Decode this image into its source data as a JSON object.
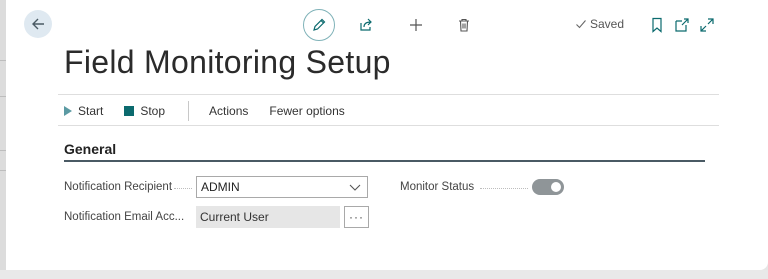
{
  "header": {
    "saved_label": "Saved",
    "icons": [
      "back-arrow-icon",
      "edit-pencil-icon",
      "share-icon",
      "plus-icon",
      "trash-icon",
      "check-icon",
      "bookmark-icon",
      "open-new-window-icon",
      "expand-icon"
    ]
  },
  "page": {
    "title": "Field Monitoring Setup"
  },
  "actions": {
    "start": "Start",
    "stop": "Stop",
    "actions": "Actions",
    "fewer_options": "Fewer options"
  },
  "section": {
    "title": "General"
  },
  "fields": {
    "recipient": {
      "label": "Notification Recipient",
      "value": "ADMIN"
    },
    "email_account": {
      "label": "Notification Email Acc...",
      "value": "Current User",
      "assist_label": "···"
    },
    "monitor_status": {
      "label": "Monitor Status",
      "enabled": true
    }
  },
  "colors": {
    "accent": "#00796b",
    "start_icon": "#5b9aa3",
    "stop_icon": "#0b6a6e",
    "toggle_track": "#8f9598",
    "back_button_bg": "#dfe9f1"
  }
}
